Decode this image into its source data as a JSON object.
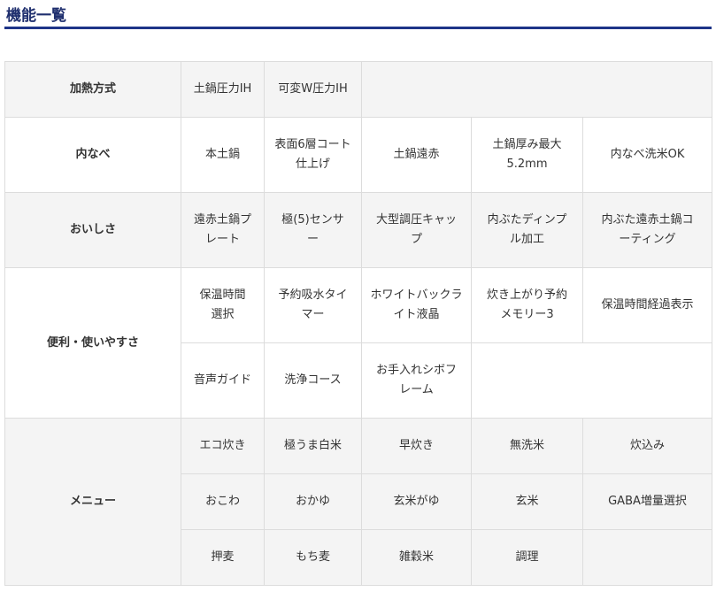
{
  "page_title": "機能一覧",
  "sections": [
    {
      "header": "加熱方式",
      "rows": [
        [
          "土鍋圧力IH",
          "可変W圧力IH"
        ]
      ]
    },
    {
      "header": "内なべ",
      "rows": [
        [
          "本土鍋",
          "表面6層コート\n仕上げ",
          "土鍋遠赤",
          "土鍋厚み最大\n5.2mm",
          "内なべ洗米OK"
        ]
      ]
    },
    {
      "header": "おいしさ",
      "rows": [
        [
          "遠赤土鍋プ\nレート",
          "極(5)センサ\nー",
          "大型調圧キャッ\nプ",
          "内ぶたディンプ\nル加工",
          "内ぶた遠赤土鍋コ\nーティング"
        ]
      ]
    },
    {
      "header": "便利・使いやすさ",
      "rows": [
        [
          "保温時間\n選択",
          "予約吸水タイ\nマー",
          "ホワイトバックラ\nイト液晶",
          "炊き上がり予約\nメモリー3",
          "保温時間経過表示"
        ],
        [
          "音声ガイド",
          "洗浄コース",
          "お手入れシボフ\nレーム"
        ]
      ]
    },
    {
      "header": "メニュー",
      "rows": [
        [
          "エコ炊き",
          "極うま白米",
          "早炊き",
          "無洗米",
          "炊込み"
        ],
        [
          "おこわ",
          "おかゆ",
          "玄米がゆ",
          "玄米",
          "GABA増量選択"
        ],
        [
          "押麦",
          "もち麦",
          "雑穀米",
          "調理"
        ]
      ]
    }
  ]
}
